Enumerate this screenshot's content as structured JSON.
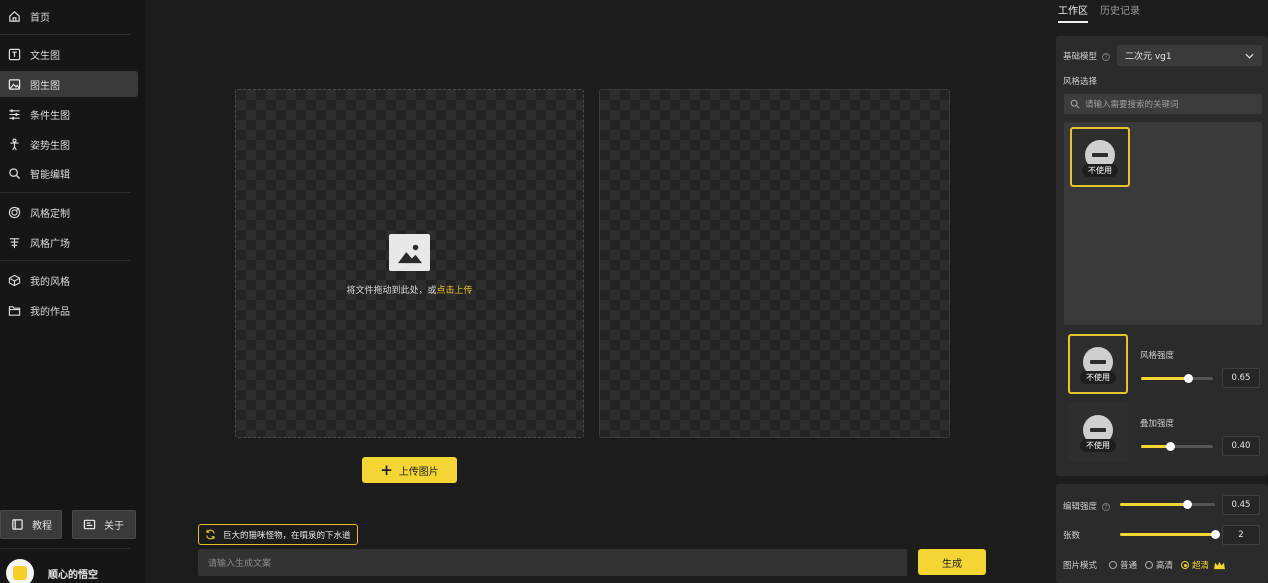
{
  "sidebar": {
    "items": [
      {
        "label": "首页",
        "icon": "home-icon"
      },
      {
        "label": "文生图",
        "icon": "text-image-icon"
      },
      {
        "label": "图生图",
        "icon": "image-icon",
        "active": true
      },
      {
        "label": "条件生图",
        "icon": "condition-icon"
      },
      {
        "label": "姿势生图",
        "icon": "pose-icon"
      },
      {
        "label": "智能编辑",
        "icon": "smart-edit-icon"
      },
      {
        "label": "风格定制",
        "icon": "style-custom-icon"
      },
      {
        "label": "风格广场",
        "icon": "style-square-icon"
      },
      {
        "label": "我的风格",
        "icon": "my-style-icon"
      },
      {
        "label": "我的作品",
        "icon": "my-works-icon"
      }
    ],
    "tutorial_label": "教程",
    "about_label": "关于",
    "user_name": "顺心的悟空"
  },
  "canvas": {
    "drop_hint_prefix": "将文件拖动到此处，或",
    "drop_hint_link": "点击上传",
    "upload_button": "上传图片"
  },
  "bottom": {
    "suggestion": "巨大的猫咪怪物，在噴泉的下水道",
    "prompt_placeholder": "请输入生成文案",
    "generate_button": "生成"
  },
  "right_panel": {
    "tabs": [
      "工作区",
      "历史记录"
    ],
    "active_tab": "工作区",
    "base_model_label": "基础模型",
    "base_model_value": "二次元 vg1",
    "style_select_label": "风格选择",
    "search_placeholder": "请输入需要搜索的关键词",
    "none_label": "不使用",
    "style_strength_label": "风格强度",
    "style_strength_value": "0.65",
    "style_strength_fraction": 0.65,
    "overlay_strength_label": "叠加强度",
    "overlay_strength_value": "0.40",
    "overlay_strength_fraction": 0.4,
    "edit_strength_label": "编辑强度",
    "edit_strength_value": "0.45",
    "edit_strength_fraction": 0.7,
    "count_label": "张数",
    "count_value": "2",
    "count_fraction": 1.0,
    "image_mode_label": "图片模式",
    "image_modes": [
      "普通",
      "高清",
      "超清"
    ],
    "image_mode_selected": "超清",
    "accent_color": "#f3d534"
  }
}
